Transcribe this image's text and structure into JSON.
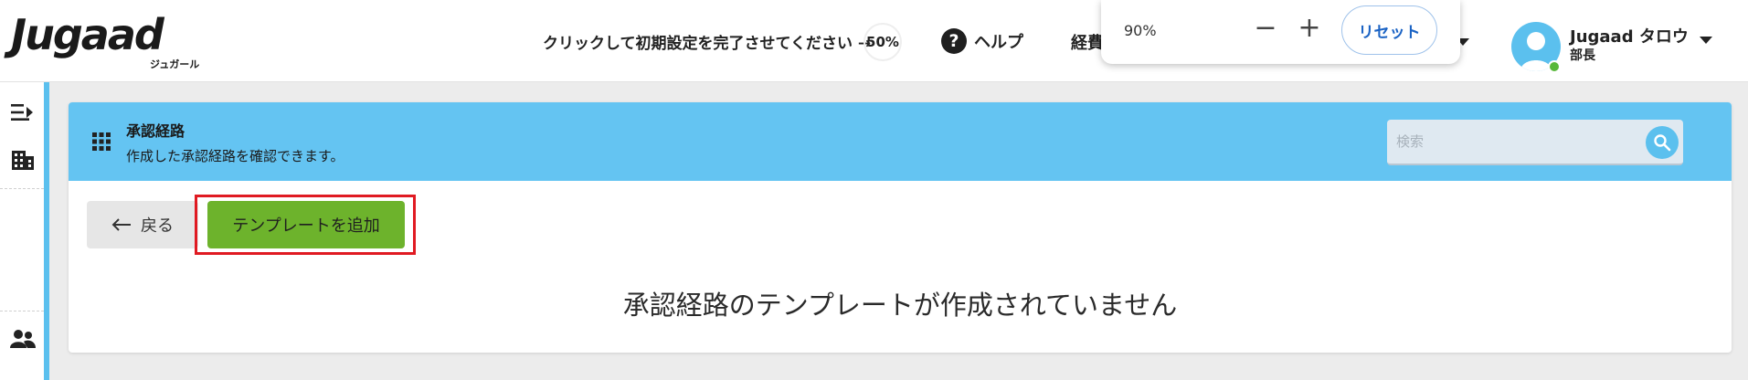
{
  "brand": {
    "logo_text": "Jugaad",
    "logo_sub": "ジュガール"
  },
  "header": {
    "setup_prompt": "クリックして初期設定を完了させてください →",
    "setup_progress": "50%",
    "help_label": "ヘルプ",
    "expense_label": "経費"
  },
  "zoom": {
    "level": "90%",
    "minus": "−",
    "plus": "+",
    "reset_label": "リセット"
  },
  "user": {
    "name": "Jugaad タロウ",
    "role": "部長",
    "status": "online",
    "status_color": "#58b83b"
  },
  "sidebar": {
    "items": [
      {
        "icon": "collapse-menu-icon"
      },
      {
        "icon": "building-icon"
      },
      {
        "icon": "people-icon"
      }
    ]
  },
  "page": {
    "title": "承認経路",
    "subtitle": "作成した承認経路を確認できます。",
    "search_placeholder": "検索",
    "back_label": "戻る",
    "add_template_label": "テンプレートを追加",
    "empty_message": "承認経路のテンプレートが作成されていません"
  },
  "colors": {
    "accent": "#64c4f2",
    "primary_button": "#6db32c",
    "highlight": "#e01a22",
    "link": "#1b63c4"
  }
}
